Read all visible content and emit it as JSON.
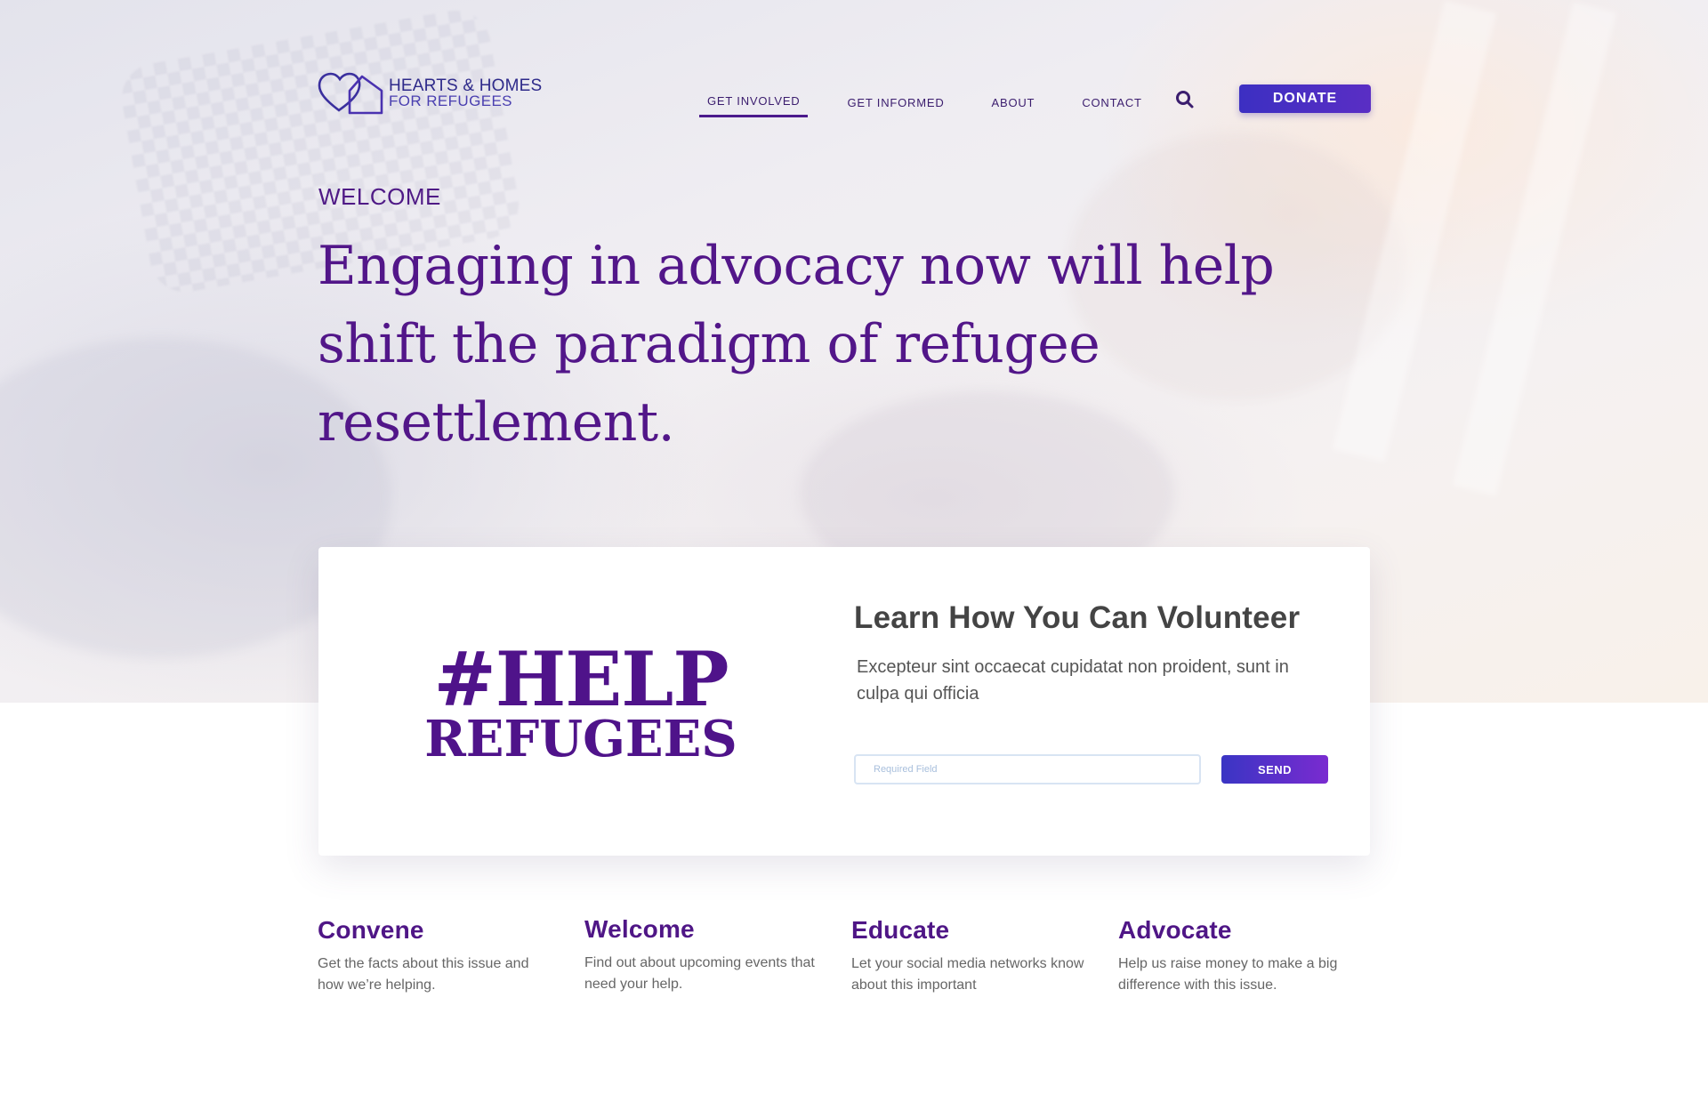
{
  "brand": {
    "name_line1": "HEARTS & HOMES",
    "name_line2": "FOR REFUGEES",
    "logo_icon": "heart-house-icon"
  },
  "nav": {
    "items": [
      {
        "label": "GET INVOLVED",
        "active": true
      },
      {
        "label": "GET INFORMED",
        "active": false
      },
      {
        "label": "ABOUT",
        "active": false
      },
      {
        "label": "CONTACT",
        "active": false
      }
    ],
    "search_icon": "search-icon",
    "donate_label": "DONATE"
  },
  "hero": {
    "eyebrow": "WELCOME",
    "title": "Engaging in advocacy now will help shift the paradigm of refugee resettlement."
  },
  "volunteer_card": {
    "hashtag_line1": "#HELP",
    "hashtag_line2": "REFUGEES",
    "title": "Learn How You Can Volunteer",
    "text": "Excepteur sint occaecat cupidatat non proident, sunt in culpa qui officia",
    "input_placeholder": "Required Field",
    "input_value": "",
    "send_label": "SEND"
  },
  "features": [
    {
      "title": "Convene",
      "desc": "Get the facts about this issue and how we’re helping."
    },
    {
      "title": "Welcome",
      "desc": "Find out about upcoming events that need your help."
    },
    {
      "title": "Educate",
      "desc": "Let your social media networks know about this important"
    },
    {
      "title": "Advocate",
      "desc": "Help us raise money to make a big difference with this issue."
    }
  ],
  "colors": {
    "primary_purple": "#521689",
    "accent_indigo": "#3c2fc2",
    "text_gray": "#555555"
  }
}
